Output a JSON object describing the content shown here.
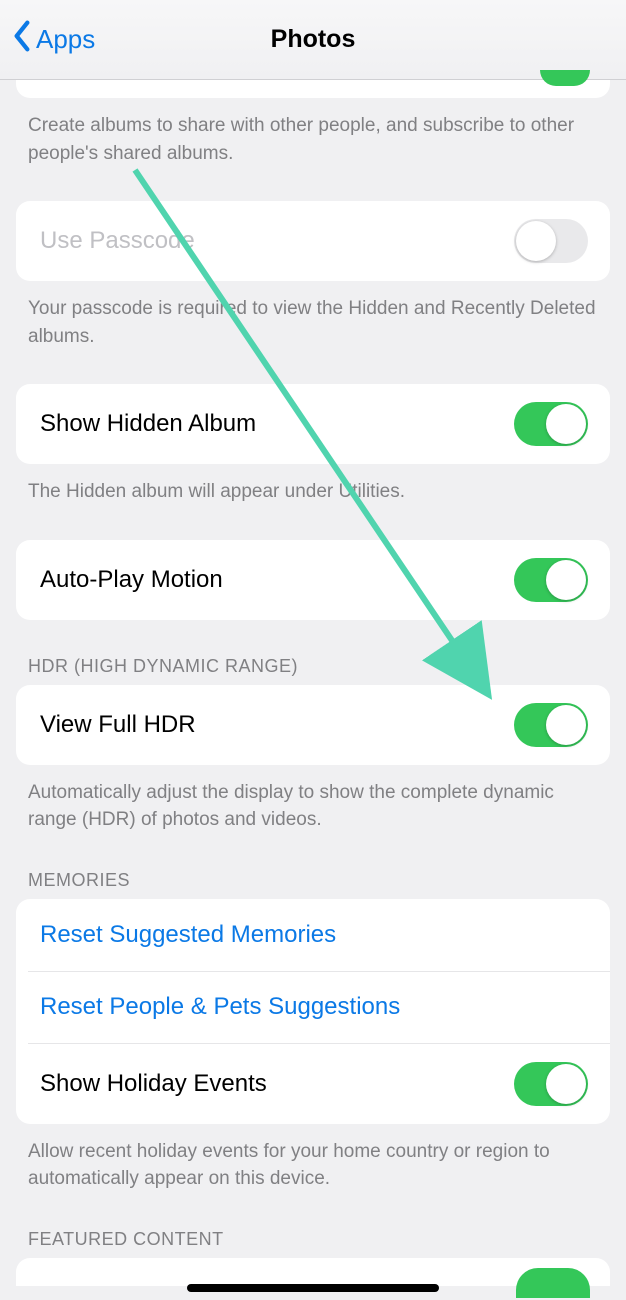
{
  "header": {
    "back_label": "Apps",
    "title": "Photos"
  },
  "sharing_footer": "Create albums to share with other people, and subscribe to other people's shared albums.",
  "use_passcode": {
    "label": "Use Passcode",
    "footer": "Your passcode is required to view the Hidden and Recently Deleted albums.",
    "on": false,
    "enabled": false
  },
  "show_hidden": {
    "label": "Show Hidden Album",
    "footer": "The Hidden album will appear under Utilities.",
    "on": true
  },
  "autoplay": {
    "label": "Auto-Play Motion",
    "on": true
  },
  "hdr": {
    "header": "HDR (HIGH DYNAMIC RANGE)",
    "label": "View Full HDR",
    "footer": "Automatically adjust the display to show the complete dynamic range (HDR) of photos and videos.",
    "on": true
  },
  "memories": {
    "header": "MEMORIES",
    "reset_memories": "Reset Suggested Memories",
    "reset_people": "Reset People & Pets Suggestions",
    "holiday_label": "Show Holiday Events",
    "holiday_on": true,
    "footer": "Allow recent holiday events for your home country or region to automatically appear on this device."
  },
  "featured": {
    "header": "FEATURED CONTENT"
  }
}
